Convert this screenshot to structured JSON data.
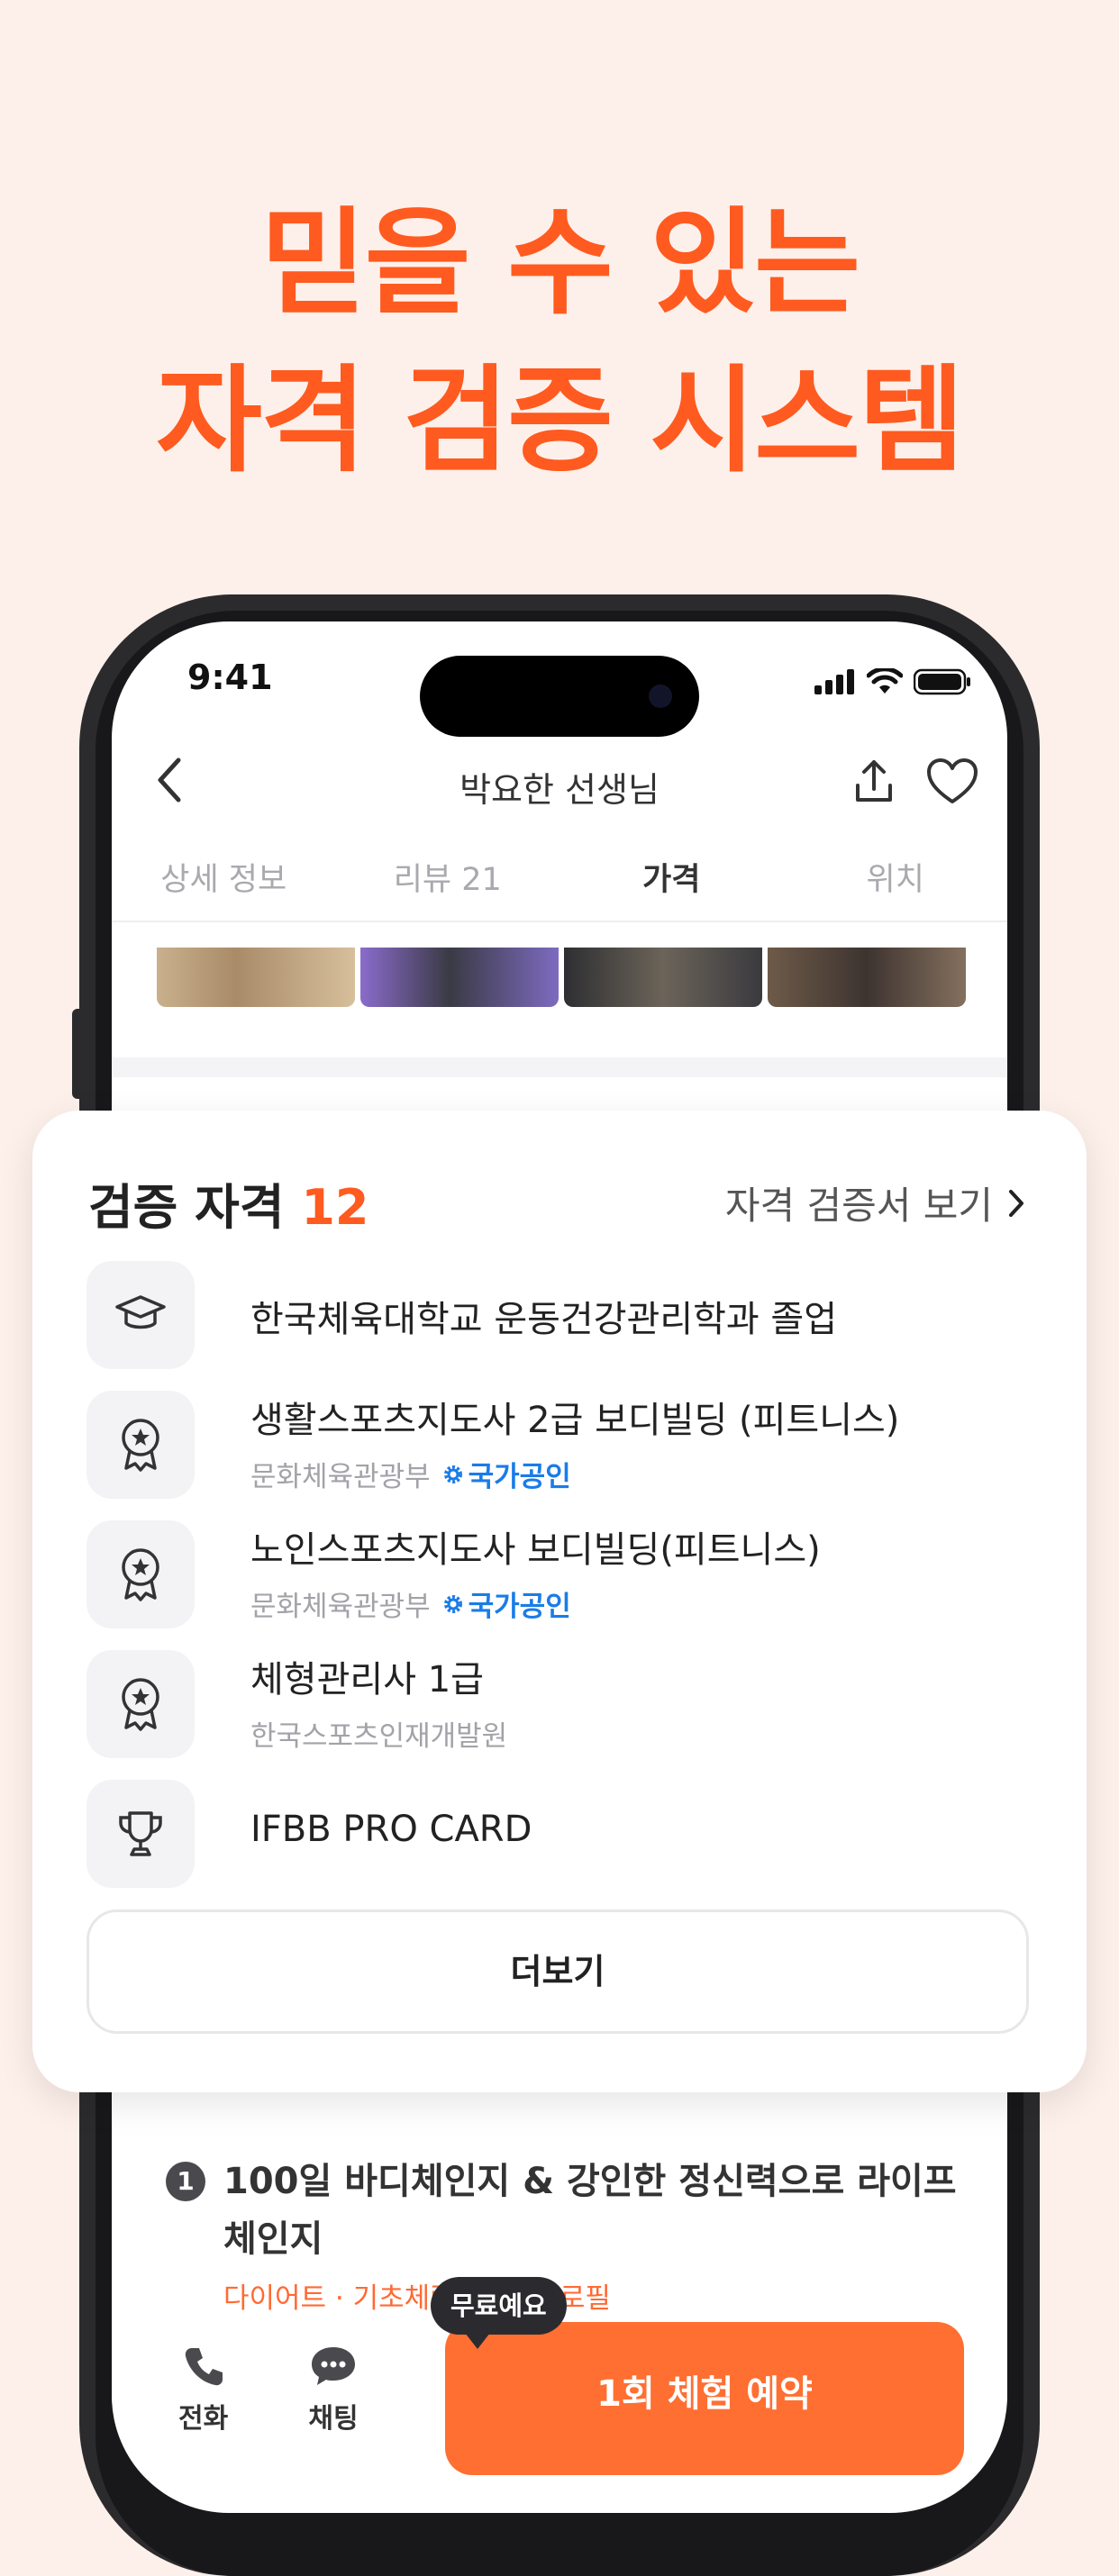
{
  "headline": {
    "line1": "믿을 수 있는",
    "line2": "자격 검증 시스템"
  },
  "status_bar": {
    "time": "9:41"
  },
  "nav": {
    "title": "박요한 선생님"
  },
  "tabs": [
    {
      "label": "상세 정보",
      "active": false
    },
    {
      "label": "리뷰 21",
      "active": false
    },
    {
      "label": "가격",
      "active": true
    },
    {
      "label": "위치",
      "active": false
    }
  ],
  "card": {
    "title": "검증 자격",
    "count": "12",
    "link": "자격 검증서 보기",
    "certs": [
      {
        "icon": "graduation-cap-icon",
        "name": "한국체육대학교 운동건강관리학과 졸업",
        "issuer": "",
        "badge": ""
      },
      {
        "icon": "award-medal-icon",
        "name": "생활스포츠지도사 2급 보디빌딩 (피트니스)",
        "issuer": "문화체육관광부",
        "badge": "국가공인"
      },
      {
        "icon": "award-medal-icon",
        "name": "노인스포츠지도사 보디빌딩(피트니스)",
        "issuer": "문화체육관광부",
        "badge": "국가공인"
      },
      {
        "icon": "award-medal-icon",
        "name": "체형관리사 1급",
        "issuer": "한국스포츠인재개발원",
        "badge": ""
      },
      {
        "icon": "trophy-icon",
        "name": "IFBB PRO CARD",
        "issuer": "",
        "badge": ""
      }
    ],
    "more_label": "더보기"
  },
  "program": {
    "number": "1",
    "title": "100일 바디체인지 & 강인한 정신력으로 라이프 체인지",
    "tags": "다이어트 · 기초체력 · 바디프로필"
  },
  "bottom_bar": {
    "call_label": "전화",
    "chat_label": "채팅",
    "tooltip": "무료예요",
    "book_label": "1회 체험 예약"
  },
  "colors": {
    "accent": "#ff5a1f",
    "background": "#fdf0ea",
    "badge_blue": "#1a7ce8"
  }
}
